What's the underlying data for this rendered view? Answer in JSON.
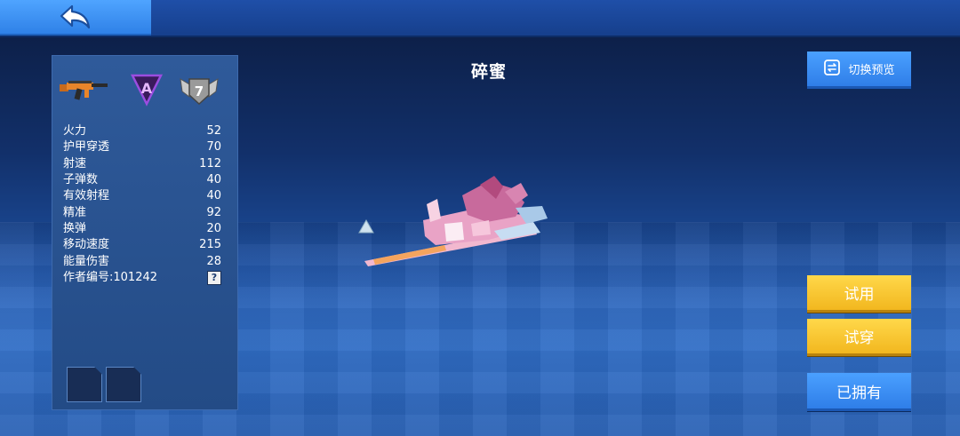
{
  "header": {
    "back_label": ""
  },
  "weapon": {
    "name": "碎蜜"
  },
  "badges": {
    "weapon_type_icon": "assault-rifle-icon",
    "rank_letter": "A",
    "level": "7"
  },
  "stats": [
    {
      "label": "火力",
      "value": "52"
    },
    {
      "label": "护甲穿透",
      "value": "70"
    },
    {
      "label": "射速",
      "value": "112"
    },
    {
      "label": "子弹数",
      "value": "40"
    },
    {
      "label": "有效射程",
      "value": "40"
    },
    {
      "label": "精准",
      "value": "92"
    },
    {
      "label": "换弹",
      "value": "20"
    },
    {
      "label": "移动速度",
      "value": "215"
    },
    {
      "label": "能量伤害",
      "value": "28"
    },
    {
      "label": "作者编号:101242",
      "value": "?"
    }
  ],
  "buttons": {
    "switch_preview": "切换预览",
    "try_use": "试用",
    "try_wear": "试穿",
    "owned": "已拥有"
  },
  "colors": {
    "accent_blue": "#2f7ee8",
    "accent_yellow": "#f2b71f",
    "panel": "#234b86"
  }
}
